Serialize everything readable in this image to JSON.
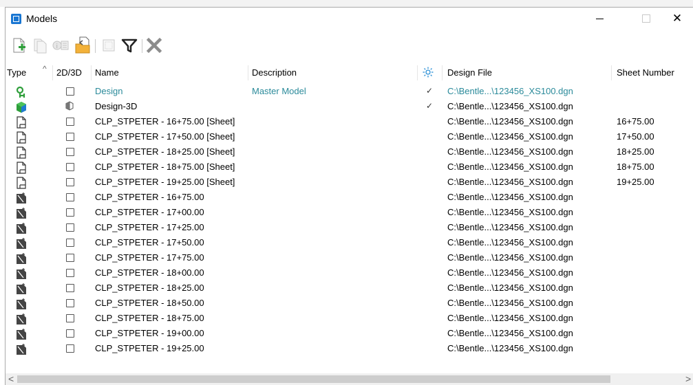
{
  "window": {
    "title": "Models",
    "minimize_glyph": "—",
    "close_glyph": "✕"
  },
  "toolbar": {
    "buttons": [
      {
        "name": "new-model-icon"
      },
      {
        "name": "copy-model-icon"
      },
      {
        "name": "properties-icon"
      },
      {
        "name": "import-model-icon"
      },
      {
        "name": "select-all-icon"
      },
      {
        "name": "filter-icon"
      },
      {
        "name": "delete-icon"
      }
    ]
  },
  "columns": {
    "type": "Type",
    "sort_glyph": "^",
    "dim": "2D/3D",
    "name": "Name",
    "description": "Description",
    "design_file": "Design File",
    "sheet_number": "Sheet Number"
  },
  "rows": [
    {
      "type_icon": "design-model-icon",
      "dim": "2d",
      "name": "Design",
      "description": "Master Model",
      "check": "✓",
      "file": "C:\\Bentle...\\123456_XS100.dgn",
      "sheet": "",
      "active": true
    },
    {
      "type_icon": "3d-model-icon",
      "dim": "3d",
      "name": "Design-3D",
      "description": "",
      "check": "✓",
      "file": "C:\\Bentle...\\123456_XS100.dgn",
      "sheet": "",
      "active": false
    },
    {
      "type_icon": "sheet-model-icon",
      "dim": "2d",
      "name": "CLP_STPETER - 16+75.00 [Sheet]",
      "description": "",
      "check": "",
      "file": "C:\\Bentle...\\123456_XS100.dgn",
      "sheet": "16+75.00",
      "active": false
    },
    {
      "type_icon": "sheet-model-icon",
      "dim": "2d",
      "name": "CLP_STPETER - 17+50.00 [Sheet]",
      "description": "",
      "check": "",
      "file": "C:\\Bentle...\\123456_XS100.dgn",
      "sheet": "17+50.00",
      "active": false
    },
    {
      "type_icon": "sheet-model-icon",
      "dim": "2d",
      "name": "CLP_STPETER - 18+25.00 [Sheet]",
      "description": "",
      "check": "",
      "file": "C:\\Bentle...\\123456_XS100.dgn",
      "sheet": "18+25.00",
      "active": false
    },
    {
      "type_icon": "sheet-model-icon",
      "dim": "2d",
      "name": "CLP_STPETER - 18+75.00 [Sheet]",
      "description": "",
      "check": "",
      "file": "C:\\Bentle...\\123456_XS100.dgn",
      "sheet": "18+75.00",
      "active": false
    },
    {
      "type_icon": "sheet-model-icon",
      "dim": "2d",
      "name": "CLP_STPETER - 19+25.00 [Sheet]",
      "description": "",
      "check": "",
      "file": "C:\\Bentle...\\123456_XS100.dgn",
      "sheet": "19+25.00",
      "active": false
    },
    {
      "type_icon": "drawing-model-icon",
      "dim": "2d",
      "name": "CLP_STPETER - 16+75.00",
      "description": "",
      "check": "",
      "file": "C:\\Bentle...\\123456_XS100.dgn",
      "sheet": "",
      "active": false
    },
    {
      "type_icon": "drawing-model-icon",
      "dim": "2d",
      "name": "CLP_STPETER - 17+00.00",
      "description": "",
      "check": "",
      "file": "C:\\Bentle...\\123456_XS100.dgn",
      "sheet": "",
      "active": false
    },
    {
      "type_icon": "drawing-model-icon",
      "dim": "2d",
      "name": "CLP_STPETER - 17+25.00",
      "description": "",
      "check": "",
      "file": "C:\\Bentle...\\123456_XS100.dgn",
      "sheet": "",
      "active": false
    },
    {
      "type_icon": "drawing-model-icon",
      "dim": "2d",
      "name": "CLP_STPETER - 17+50.00",
      "description": "",
      "check": "",
      "file": "C:\\Bentle...\\123456_XS100.dgn",
      "sheet": "",
      "active": false
    },
    {
      "type_icon": "drawing-model-icon",
      "dim": "2d",
      "name": "CLP_STPETER - 17+75.00",
      "description": "",
      "check": "",
      "file": "C:\\Bentle...\\123456_XS100.dgn",
      "sheet": "",
      "active": false
    },
    {
      "type_icon": "drawing-model-icon",
      "dim": "2d",
      "name": "CLP_STPETER - 18+00.00",
      "description": "",
      "check": "",
      "file": "C:\\Bentle...\\123456_XS100.dgn",
      "sheet": "",
      "active": false
    },
    {
      "type_icon": "drawing-model-icon",
      "dim": "2d",
      "name": "CLP_STPETER - 18+25.00",
      "description": "",
      "check": "",
      "file": "C:\\Bentle...\\123456_XS100.dgn",
      "sheet": "",
      "active": false
    },
    {
      "type_icon": "drawing-model-icon",
      "dim": "2d",
      "name": "CLP_STPETER - 18+50.00",
      "description": "",
      "check": "",
      "file": "C:\\Bentle...\\123456_XS100.dgn",
      "sheet": "",
      "active": false
    },
    {
      "type_icon": "drawing-model-icon",
      "dim": "2d",
      "name": "CLP_STPETER - 18+75.00",
      "description": "",
      "check": "",
      "file": "C:\\Bentle...\\123456_XS100.dgn",
      "sheet": "",
      "active": false
    },
    {
      "type_icon": "drawing-model-icon",
      "dim": "2d",
      "name": "CLP_STPETER - 19+00.00",
      "description": "",
      "check": "",
      "file": "C:\\Bentle...\\123456_XS100.dgn",
      "sheet": "",
      "active": false
    },
    {
      "type_icon": "drawing-model-icon",
      "dim": "2d",
      "name": "CLP_STPETER - 19+25.00",
      "description": "",
      "check": "",
      "file": "C:\\Bentle...\\123456_XS100.dgn",
      "sheet": "",
      "active": false
    }
  ],
  "scrollbar": {
    "left_glyph": "<",
    "right_glyph": ">"
  },
  "colors": {
    "active_text": "#2a8a9a",
    "accent": "#1976d2",
    "green_plus": "#2e9e3a"
  }
}
